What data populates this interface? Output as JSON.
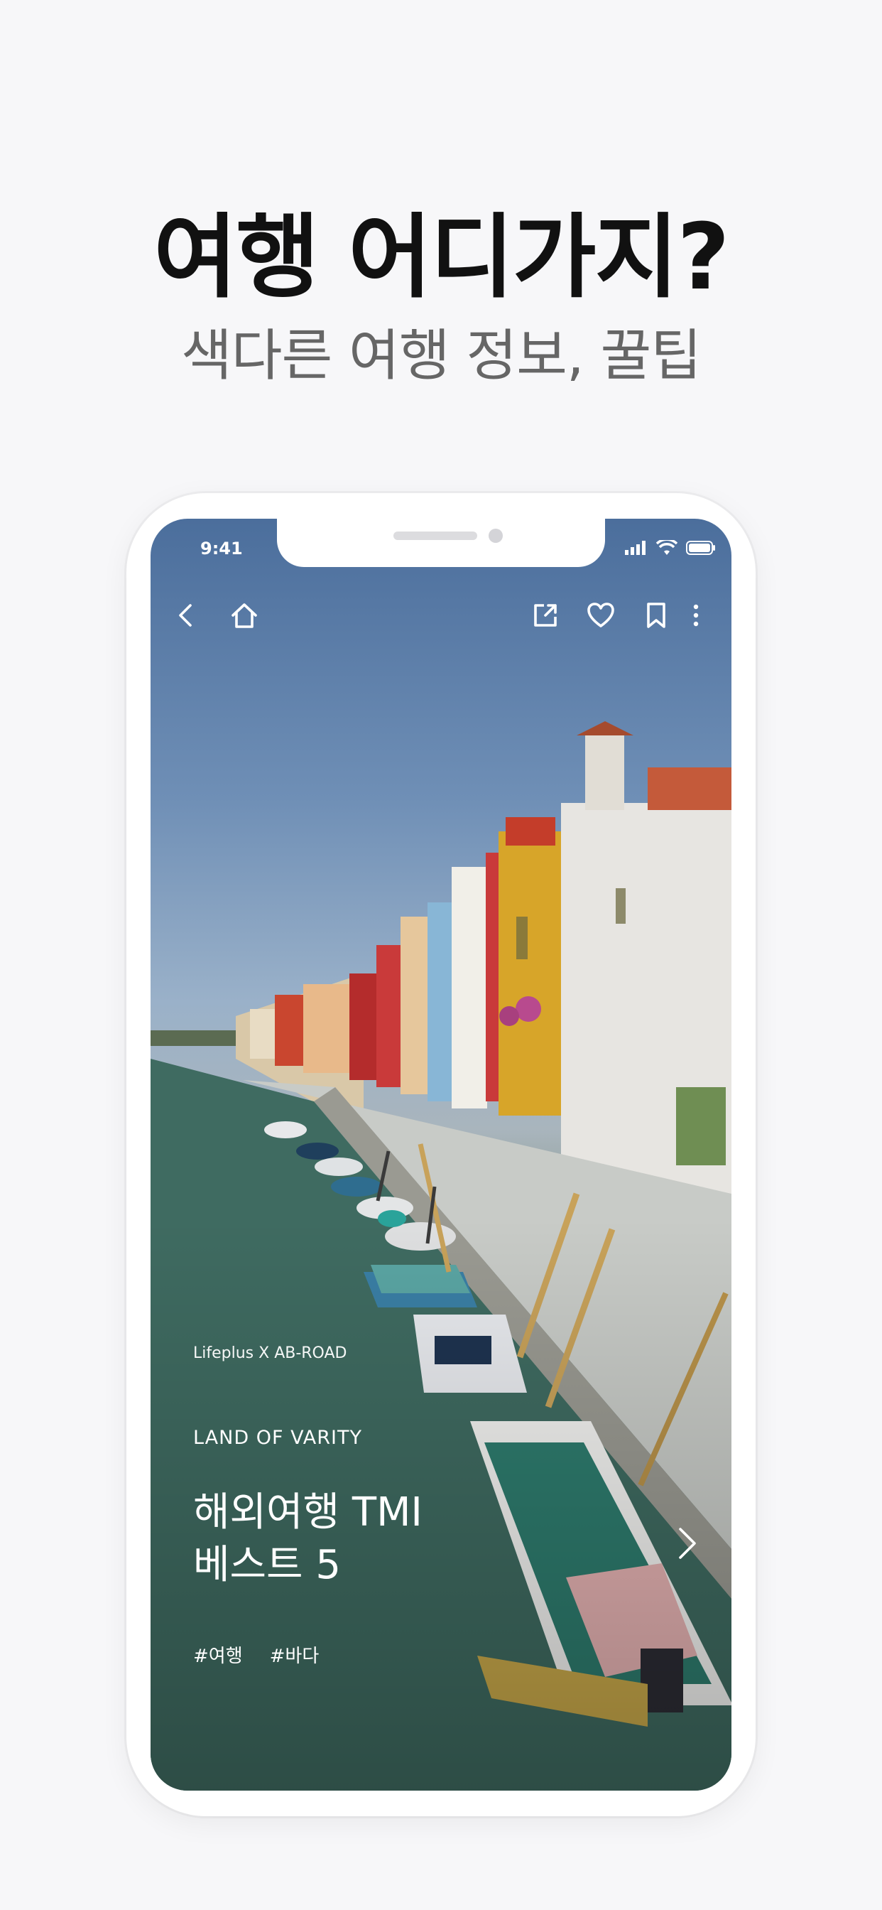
{
  "promo": {
    "headline": "여행 어디가지?",
    "subline": "색다른 여행 정보, 꿀팁"
  },
  "status_bar": {
    "time": "9:41"
  },
  "toolbar": {
    "icons": [
      "back-icon",
      "home-icon",
      "share-icon",
      "heart-icon",
      "bookmark-icon",
      "more-icon"
    ]
  },
  "article": {
    "credit": "Lifeplus X AB-ROAD",
    "category": "LAND OF VARITY",
    "title": "해외여행 TMI\n베스트 5",
    "tags": [
      "#여행",
      "#바다"
    ]
  },
  "colors": {
    "background": "#f7f7f9",
    "headline": "#111111",
    "subline": "#666666",
    "overlay_text": "#ffffff"
  }
}
